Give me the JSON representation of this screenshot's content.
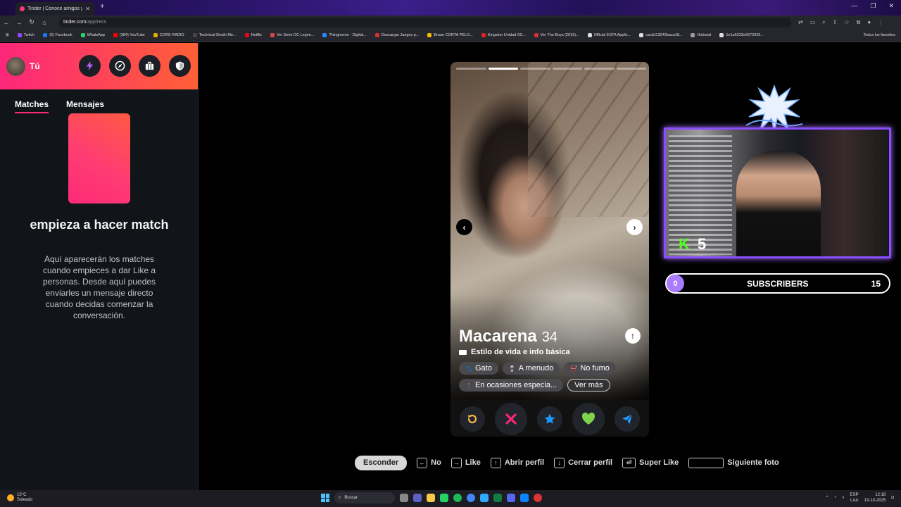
{
  "browser": {
    "tab_title": "Tinder | Conoce amigos y gen",
    "url_host": "tinder.com",
    "url_path": "/app/recs",
    "window_controls": [
      "—",
      "❐",
      "✕"
    ],
    "bookmarks": [
      {
        "label": "Twitch",
        "color": "#9146ff"
      },
      {
        "label": "(6) Facebook",
        "color": "#1877f2"
      },
      {
        "label": "WhatsApp",
        "color": "#25d366"
      },
      {
        "label": "(384) YouTube",
        "color": "#ff0000"
      },
      {
        "label": "CORE RADIO",
        "color": "#e0b000"
      },
      {
        "label": "Technical Death Me...",
        "color": "#444"
      },
      {
        "label": "Netflix",
        "color": "#e50914"
      },
      {
        "label": "Ver Serie DC Legen...",
        "color": "#d44"
      },
      {
        "label": "Thingiverse - Digital...",
        "color": "#248bfb"
      },
      {
        "label": "Descargar Juegos p...",
        "color": "#c33"
      },
      {
        "label": "Braun CORTA PELO...",
        "color": "#f0c000"
      },
      {
        "label": "Kingston Unidad SS...",
        "color": "#d22"
      },
      {
        "label": "Ver The Boys (2019)...",
        "color": "#c33"
      },
      {
        "label": "Official ESTA Applic...",
        "color": "#ddd"
      },
      {
        "label": "cacb113243baca18...",
        "color": "#ddd"
      },
      {
        "label": "Historial",
        "color": "#999"
      },
      {
        "label": "1e1a6233e9272639...",
        "color": "#ddd"
      }
    ],
    "bookmarks_all": "Todos los favoritos"
  },
  "sidebar": {
    "user_label": "Tú",
    "header_buttons": [
      "boost-icon",
      "explore-icon",
      "briefcase-icon",
      "shield-icon"
    ],
    "tabs": [
      "Matches",
      "Mensajes"
    ],
    "active_tab": "Matches",
    "empty_title": "empieza a hacer match",
    "empty_body": "Aquí aparecerán los matches cuando empieces a dar Like a personas. Desde aquí puedes enviarles un mensaje directo cuando decidas comenzar la conversación."
  },
  "profile": {
    "name": "Macarena",
    "age": "34",
    "photo_count": 6,
    "active_photo_index": 1,
    "section_label": "Estilo de vida e info básica",
    "chips": [
      {
        "icon": "paw-icon",
        "glyph": "🐾",
        "label": "Gato"
      },
      {
        "icon": "glass-icon",
        "glyph": "🍷",
        "label": "A menudo"
      },
      {
        "icon": "smoke-icon",
        "glyph": "🚭",
        "label": "No fumo"
      },
      {
        "icon": "figure-icon",
        "glyph": "🕴",
        "label": "En ocasiones especia..."
      }
    ],
    "more_label": "Ver más",
    "actions": [
      "rewind",
      "nope",
      "super-like",
      "like",
      "boost"
    ],
    "colors": {
      "rewind": "#f5b748",
      "nope": "#fd267a",
      "super_like": "#1e9aff",
      "like": "#7fd34b",
      "boost": "#1ea0ff"
    }
  },
  "hints": {
    "hide_label": "Esconder",
    "items": [
      {
        "key": "←",
        "label": "No"
      },
      {
        "key": "→",
        "label": "Like"
      },
      {
        "key": "↑",
        "label": "Abrir perfil"
      },
      {
        "key": "↓",
        "label": "Cerrar perfil"
      },
      {
        "key": "⏎",
        "label": "Super Like"
      },
      {
        "key": "",
        "label": "Siguiente foto"
      }
    ]
  },
  "overlay": {
    "kick_letter": "K",
    "kick_count": "5",
    "subs_current": "0",
    "subs_label": "SUBSCRIBERS",
    "subs_goal": "15",
    "accent": "#8a4dff"
  },
  "taskbar": {
    "temp": "15°C",
    "weather": "Soleado",
    "search_placeholder": "Buscar",
    "lang_top": "ESP",
    "lang_bottom": "LAA",
    "time": "12:18",
    "date": "13-10-2025"
  }
}
